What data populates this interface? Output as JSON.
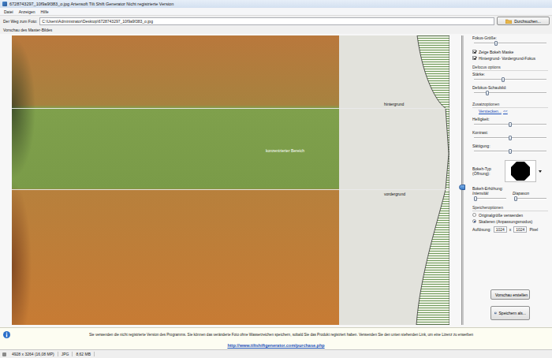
{
  "window": {
    "title": "6728743297_10f9a9f383_o.jpg Artensoft Tilt Shift Generator Nicht registrierte Version"
  },
  "menu": [
    "Datei",
    "Anzeigen",
    "Hilfe"
  ],
  "path": {
    "label": "Der Weg zum Foto:",
    "value": "C:\\Users\\Administrator\\Desktop\\6728743297_10f9a9f383_o.jpg",
    "button": "Durchsuchen..."
  },
  "preview": {
    "title": "Vorschau des Master-Bildes",
    "zones": [
      {
        "label": "hintergrund"
      },
      {
        "label": "konzentrierter Bereich"
      },
      {
        "label": "vordergrund"
      }
    ],
    "focus_slider": {
      "level": 0.52
    }
  },
  "panel": [
    {
      "kind": "slider",
      "label": "Fokus-Größe:",
      "level": 0.3
    },
    {
      "kind": "checkbox",
      "label": "Zeige Bokeh Maske",
      "checked": true
    },
    {
      "kind": "checkbox",
      "label": "Hintergrund- Vordergrund-Fokus",
      "checked": true
    },
    {
      "kind": "heading",
      "label": "Defocus options"
    },
    {
      "kind": "slider",
      "label": "Stärke:",
      "level": 0.4
    },
    {
      "kind": "slider",
      "label": "Defokus-Schaubild:",
      "level": 0.18
    },
    {
      "kind": "heading",
      "label": "Zusatzoptionen"
    },
    {
      "kind": "link",
      "label": "Verstecken...",
      "suffix": "<<"
    },
    {
      "kind": "slider",
      "label": "Helligkeit:",
      "level": 0.5
    },
    {
      "kind": "slider",
      "label": "Kontrast:",
      "level": 0.5
    },
    {
      "kind": "slider",
      "label": "Sättigung:",
      "level": 0.5
    },
    {
      "kind": "bokeh",
      "label": "Bokeh-Typ (Öffnung):"
    },
    {
      "kind": "dual",
      "label": "Bokeh-Erhöhung:",
      "subs": [
        {
          "label": "Intensität",
          "level": 0.05
        },
        {
          "label": "Diapason",
          "level": 0.05
        }
      ]
    },
    {
      "kind": "heading",
      "label": "Speicheroptionen"
    },
    {
      "kind": "radio",
      "label": "Originalgröße verwenden",
      "selected": false
    },
    {
      "kind": "radio",
      "label": "Skalieren (Anpassungsmodus)",
      "selected": true
    },
    {
      "kind": "resolution",
      "label": "Auflösung:",
      "width": "1024",
      "sep": "x",
      "height": "1024",
      "unit": "Pixel"
    }
  ],
  "buttons": [
    {
      "label": "Vorschau erstellen"
    },
    {
      "label": "Speichern als..."
    }
  ],
  "info": {
    "text": "Sie verwenden die nicht registrierte Version des Programms. Sie können das veränderte Foto ohne Wasserzeichen speichern, sobald Sie das Produkt registriert haben. Verwenden Sie den unten stehenden Link, um eine Lizenz zu erwerben",
    "link": "http://www.tiltshiftgenerator.com/purchase.php"
  },
  "status_bar": [
    "4928 x 3264 (16,08 MP)",
    "JPG",
    "8,62 MB"
  ]
}
